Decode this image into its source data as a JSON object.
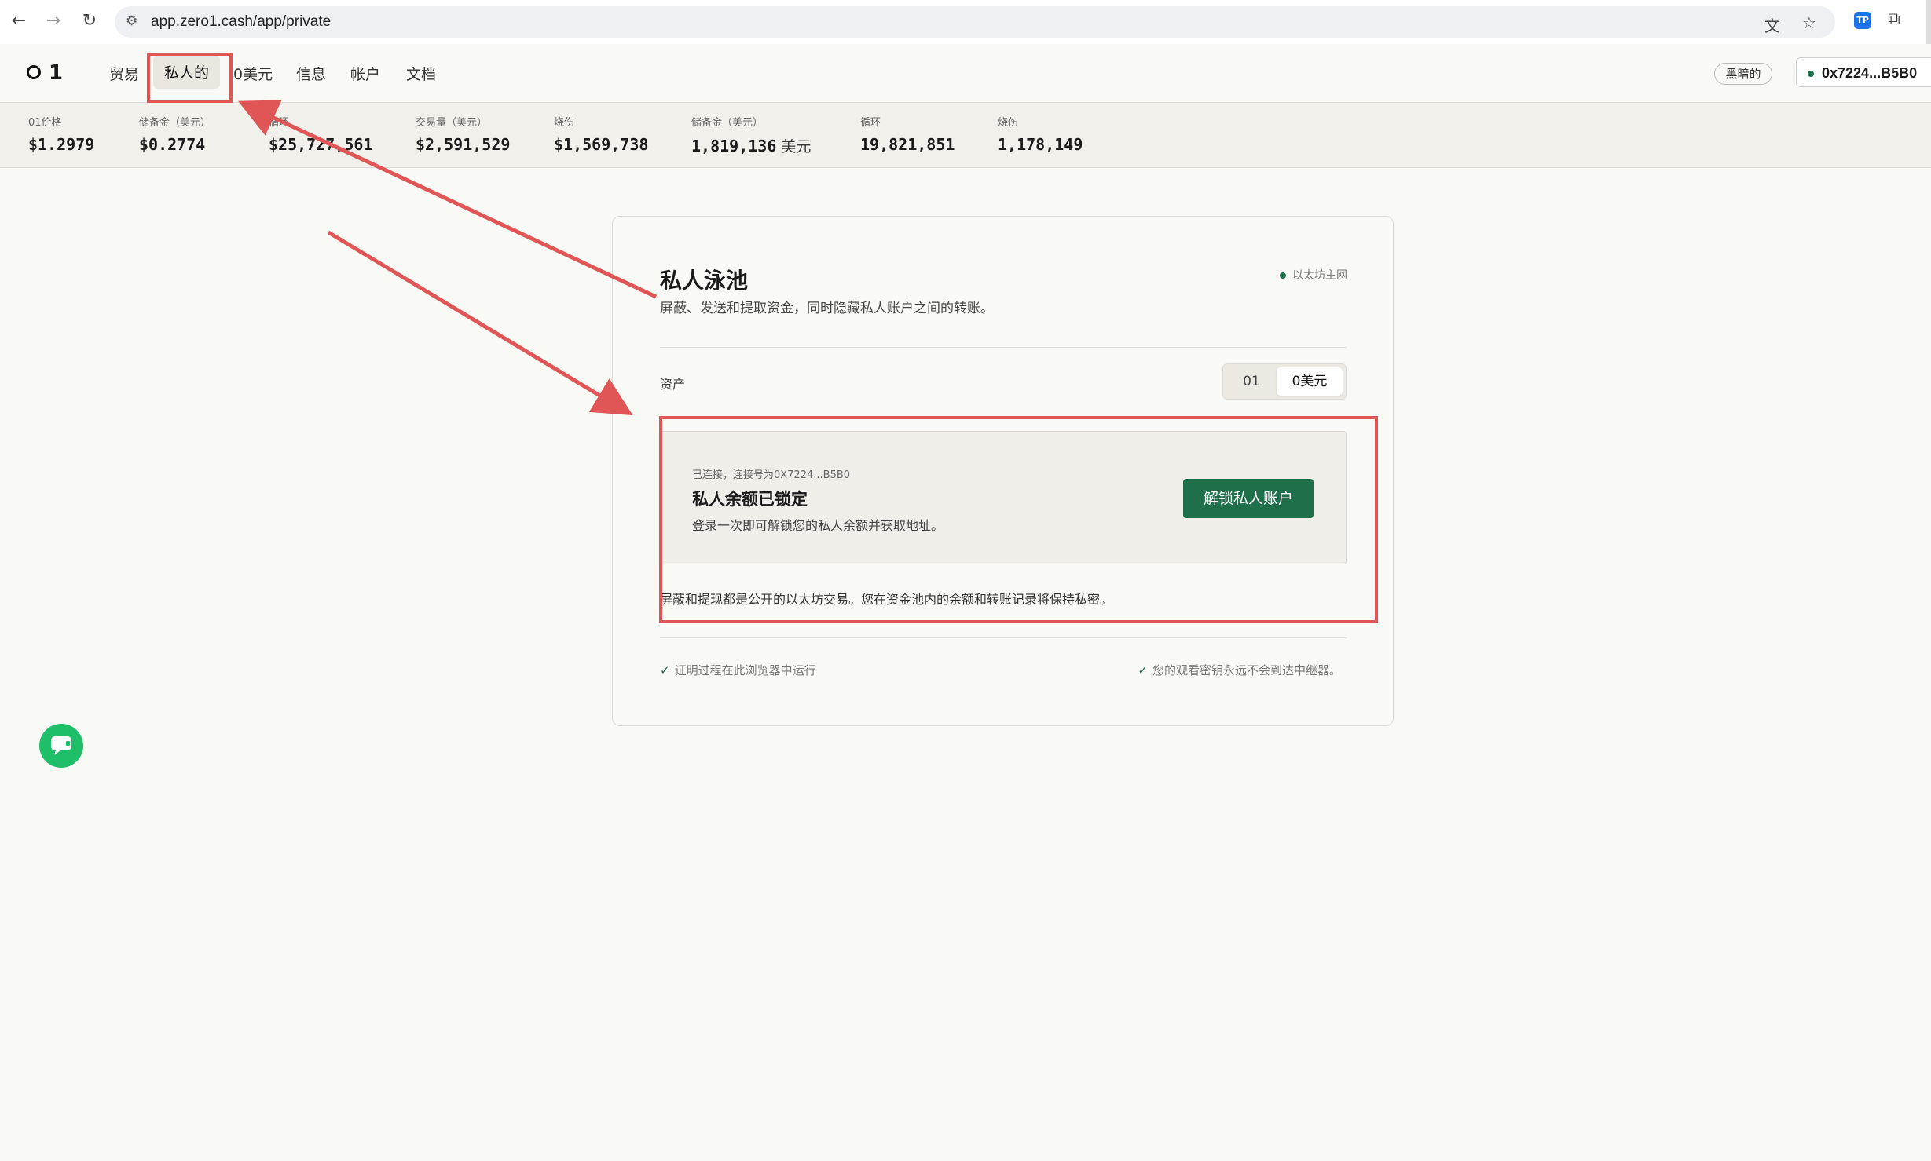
{
  "browser": {
    "url": "app.zero1.cash/app/private",
    "extension_label": "TP"
  },
  "header": {
    "logo": "1",
    "nav": [
      {
        "label": "贸易"
      },
      {
        "label": "私人的"
      },
      {
        "label": "0美元"
      },
      {
        "label": "信息"
      },
      {
        "label": "帐户"
      },
      {
        "label": "文档"
      }
    ],
    "theme_label": "黑暗的",
    "wallet_label": "0x7224...B5B0"
  },
  "stats": [
    {
      "label": "01价格",
      "value": "$1.2979"
    },
    {
      "label": "储备金（美元）",
      "value": "$0.2774"
    },
    {
      "label": "循环",
      "value": "$25,727,561"
    },
    {
      "label": "交易量（美元）",
      "value": "$2,591,529"
    },
    {
      "label": "烧伤",
      "value": "$1,569,738"
    },
    {
      "label": "储备金（美元）",
      "value": "1,819,136",
      "unit": "美元"
    },
    {
      "label": "循环",
      "value": "19,821,851"
    },
    {
      "label": "烧伤",
      "value": "1,178,149"
    }
  ],
  "card": {
    "title": "私人泳池",
    "description": "屏蔽、发送和提取资金，同时隐藏私人账户之间的转账。",
    "network": "以太坊主网",
    "asset_label": "资产",
    "asset_options": [
      "01",
      "0美元"
    ],
    "asset_selected": "0美元",
    "locked": {
      "connection": "已连接，连接号为0X7224...B5B0",
      "title": "私人余额已锁定",
      "description": "登录一次即可解锁您的私人余额并获取地址。",
      "button": "解锁私人账户"
    },
    "public_note": "屏蔽和提现都是公开的以太坊交易。您在资金池内的余额和转账记录将保持私密。",
    "footer_left": "证明过程在此浏览器中运行",
    "footer_right": "您的观看密钥永远不会到达中继器。"
  },
  "colors": {
    "accent": "#1e6f4a",
    "annotation": "#e05555",
    "chat": "#1fbf6a"
  }
}
